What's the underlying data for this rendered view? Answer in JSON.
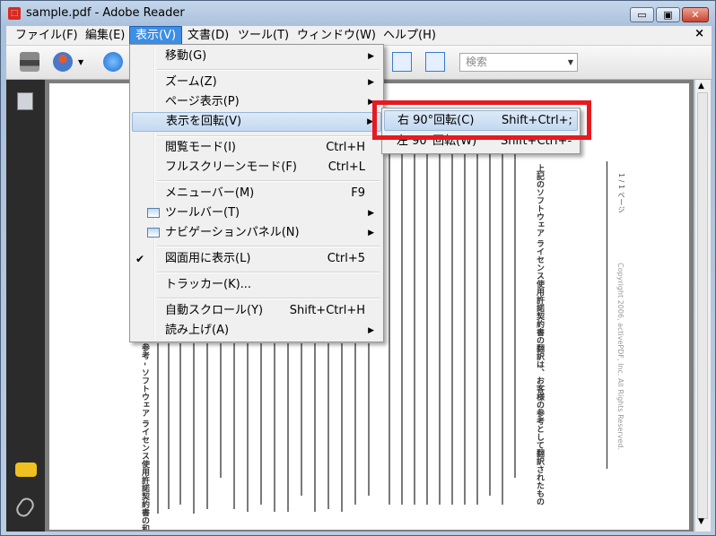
{
  "window": {
    "title": "sample.pdf - Adobe Reader",
    "app_icon": "pdf-icon"
  },
  "window_buttons": {
    "minimize": "▭",
    "maximize": "▣",
    "close": "✕"
  },
  "menubar": {
    "items": [
      {
        "label": "ファイル(F)"
      },
      {
        "label": "編集(E)"
      },
      {
        "label": "表示(V)"
      },
      {
        "label": "文書(D)"
      },
      {
        "label": "ツール(T)"
      },
      {
        "label": "ウィンドウ(W)"
      },
      {
        "label": "ヘルプ(H)"
      }
    ],
    "doc_close": "×"
  },
  "toolbar": {
    "search_placeholder": "検索"
  },
  "view_menu": {
    "items": [
      {
        "label": "移動(G)",
        "shortcut": "",
        "submenu": true
      },
      {
        "label": "ズーム(Z)",
        "shortcut": "",
        "submenu": true
      },
      {
        "label": "ページ表示(P)",
        "shortcut": "",
        "submenu": true
      },
      {
        "label": "表示を回転(V)",
        "shortcut": "",
        "submenu": true
      },
      {
        "label": "閲覧モード(I)",
        "shortcut": "Ctrl+H",
        "submenu": false
      },
      {
        "label": "フルスクリーンモード(F)",
        "shortcut": "Ctrl+L",
        "submenu": false
      },
      {
        "label": "メニューバー(M)",
        "shortcut": "F9",
        "submenu": false
      },
      {
        "label": "ツールバー(T)",
        "shortcut": "",
        "submenu": true
      },
      {
        "label": "ナビゲーションパネル(N)",
        "shortcut": "",
        "submenu": true
      },
      {
        "label": "図面用に表示(L)",
        "shortcut": "Ctrl+5",
        "submenu": false,
        "checked": true
      },
      {
        "label": "トラッカー(K)...",
        "shortcut": "",
        "submenu": false
      },
      {
        "label": "自動スクロール(Y)",
        "shortcut": "Shift+Ctrl+H",
        "submenu": false
      },
      {
        "label": "読み上げ(A)",
        "shortcut": "",
        "submenu": true
      }
    ],
    "arrow": "▶",
    "check": "✔"
  },
  "rotate_submenu": {
    "items": [
      {
        "label": "右 90°回転(C)",
        "shortcut": "Shift+Ctrl+;"
      },
      {
        "label": "左 90°回転(W)",
        "shortcut": "Shift+Ctrl+-"
      }
    ]
  },
  "document": {
    "heading": "参考 - ソフトウェア ライセンス使用許諾契約書の和訳",
    "page_label": "1 / 1 ページ",
    "copyright": "Copyright 2006, activePDF, Inc. All Rights Reserved.",
    "right_heading": "上記のソフトウェア ライセンス使用許諾契約書の翻訳は、お客様の参考として翻訳されたものです。"
  },
  "colors": {
    "highlight_box": "#e8191f",
    "menu_active": "#3d8ee5"
  }
}
